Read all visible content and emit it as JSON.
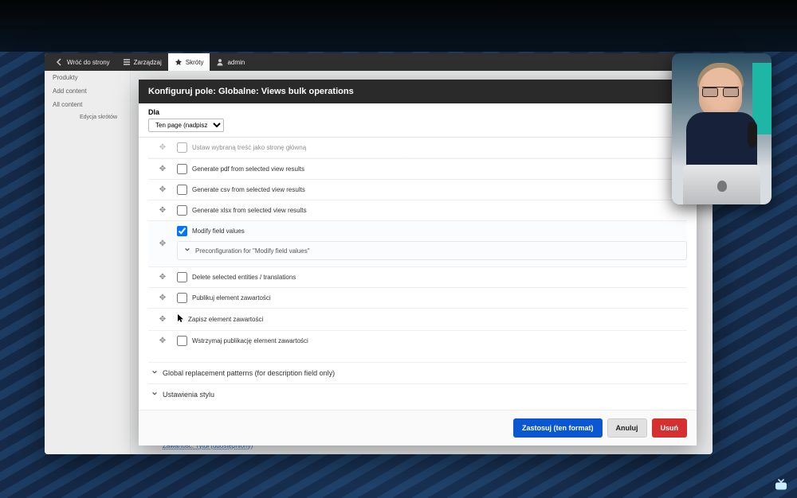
{
  "toolbar": {
    "back": "Wróć do strony",
    "manage": "Zarządzaj",
    "shortcuts": "Skróty",
    "user": "admin"
  },
  "sidebar": {
    "items": [
      "Produkty",
      "Add content",
      "All content"
    ],
    "subitem": "Edycja skrótów"
  },
  "modal": {
    "title": "Konfiguruj pole: Globalne: Views bulk operations",
    "for_label": "Dla",
    "for_value": "Ten page (nadpisz)"
  },
  "operations": [
    {
      "label": "Ustaw wybraną treść jako stronę główną",
      "checked": false,
      "faded": true
    },
    {
      "label": "Generate pdf from selected view results",
      "checked": false
    },
    {
      "label": "Generate csv from selected view results",
      "checked": false
    },
    {
      "label": "Generate xlsx from selected view results",
      "checked": false
    },
    {
      "label": "Modify field values",
      "checked": true,
      "preconfig": "Preconfiguration for \"Modify field values\""
    },
    {
      "label": "Delete selected entities / translations",
      "checked": false
    },
    {
      "label": "Publikuj element zawartości",
      "checked": false
    },
    {
      "label": "Zapisz element zawartości",
      "checked": false,
      "cursor": true,
      "nocheck": true
    },
    {
      "label": "Wstrzymaj publikację element zawartości",
      "checked": false
    }
  ],
  "accordions": {
    "global_patterns": "Global replacement patterns (for description field only)",
    "style": "Ustawienia stylu"
  },
  "buttons": {
    "apply": "Zastosuj (ten format)",
    "cancel": "Anuluj",
    "delete": "Usuń"
  },
  "footer_link": "Zawartość: Tytuł (udostępniony)"
}
